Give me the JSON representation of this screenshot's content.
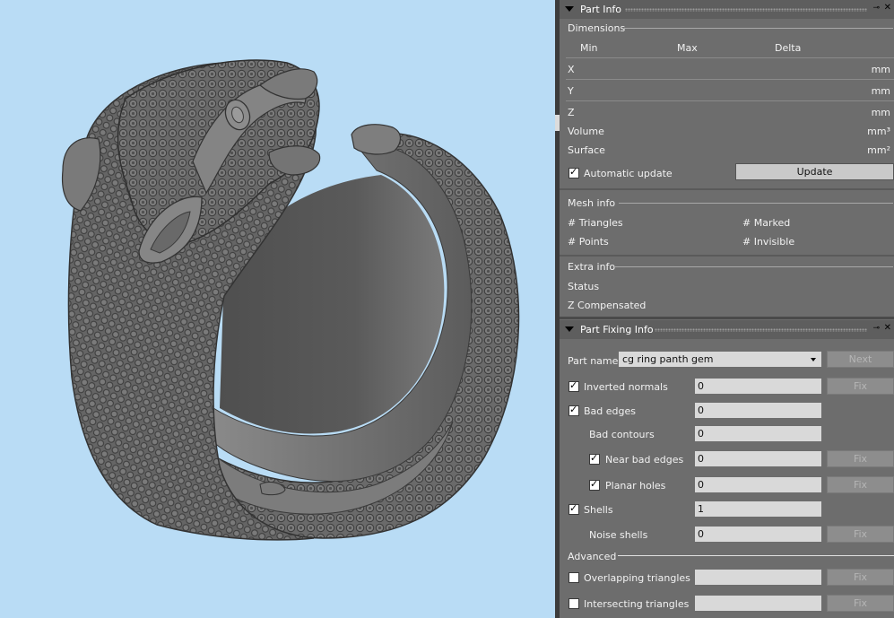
{
  "part_info": {
    "title": "Part Info",
    "dimensions": {
      "section": "Dimensions",
      "columns": [
        "Min",
        "Max",
        "Delta"
      ],
      "rows": [
        {
          "axis": "X",
          "unit": "mm"
        },
        {
          "axis": "Y",
          "unit": "mm"
        },
        {
          "axis": "Z",
          "unit": "mm"
        }
      ],
      "volume_label": "Volume",
      "volume_unit": "mm³",
      "surface_label": "Surface",
      "surface_unit": "mm²",
      "auto_update_label": "Automatic update",
      "auto_update_checked": true,
      "update_button": "Update"
    },
    "mesh_info": {
      "section": "Mesh info",
      "triangles": "# Triangles",
      "marked": "# Marked",
      "points": "# Points",
      "invisible": "# Invisible"
    },
    "extra_info": {
      "section": "Extra info",
      "status": "Status",
      "z_compensated": "Z Compensated"
    }
  },
  "part_fixing": {
    "title": "Part Fixing Info",
    "part_name_label": "Part name",
    "part_name_value": "cg ring panth gem",
    "next_button": "Next",
    "fix_label": "Fix",
    "inverted_normals": {
      "label": "Inverted normals",
      "value": "0",
      "checked": true
    },
    "bad_edges": {
      "label": "Bad edges",
      "value": "0",
      "checked": true
    },
    "bad_contours": {
      "label": "Bad contours",
      "value": "0"
    },
    "near_bad_edges": {
      "label": "Near bad edges",
      "value": "0",
      "checked": true
    },
    "planar_holes": {
      "label": "Planar holes",
      "value": "0",
      "checked": true
    },
    "shells": {
      "label": "Shells",
      "value": "1",
      "checked": true
    },
    "noise_shells": {
      "label": "Noise shells",
      "value": "0"
    },
    "advanced_section": "Advanced",
    "overlapping": {
      "label": "Overlapping triangles",
      "value": "",
      "checked": false
    },
    "intersecting": {
      "label": "Intersecting triangles",
      "value": "",
      "checked": false
    }
  },
  "colors": {
    "viewport_bg": "#b9dcf5",
    "panel_bg": "#6d6d6d",
    "model_gray": "#6f6f6f"
  }
}
